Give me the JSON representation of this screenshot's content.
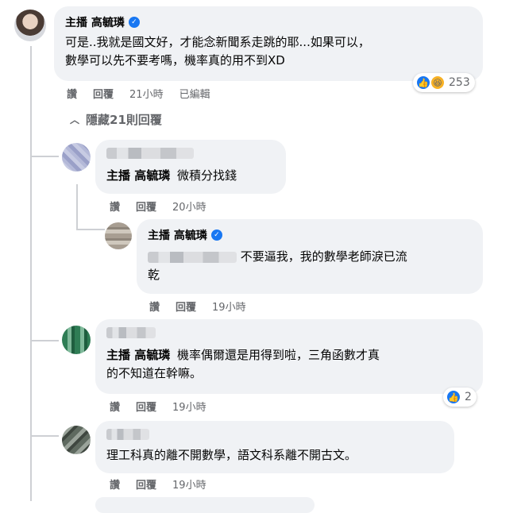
{
  "comment1": {
    "author": "主播 高毓璘",
    "text_line1": "可是..我就是國文好，才能念新聞系走跳的耶...如果可以，",
    "text_line2": "數學可以先不要考嗎，機率真的用不到XD",
    "actions": {
      "like": "讚",
      "reply": "回覆",
      "time": "21小時",
      "edited": "已編輯"
    },
    "reaction_count": "253"
  },
  "hide_replies": {
    "label": "隱藏21則回覆"
  },
  "reply1": {
    "tag": "主播 高毓璘",
    "text": "微積分找錢",
    "actions": {
      "like": "讚",
      "reply": "回覆",
      "time": "20小時"
    }
  },
  "reply1_sub": {
    "author": "主播 高毓璘",
    "text_line1": "不要逼我，我的數學老師淚已流",
    "text_line2": "乾",
    "actions": {
      "like": "讚",
      "reply": "回覆",
      "time": "19小時"
    }
  },
  "reply2": {
    "tag": "主播 高毓璘",
    "text_line1": "機率偶爾還是用得到啦，三角函數才真",
    "text_line2": "的不知道在幹嘛。",
    "actions": {
      "like": "讚",
      "reply": "回覆",
      "time": "19小時"
    },
    "reaction_count": "2"
  },
  "reply3": {
    "text": "理工科真的離不開數學，語文科系離不開古文。",
    "actions": {
      "like": "讚",
      "reply": "回覆",
      "time": "19小時"
    }
  },
  "colors": {
    "bubble": "#f0f2f5",
    "accent": "#1877f2",
    "meta": "#65676b"
  }
}
